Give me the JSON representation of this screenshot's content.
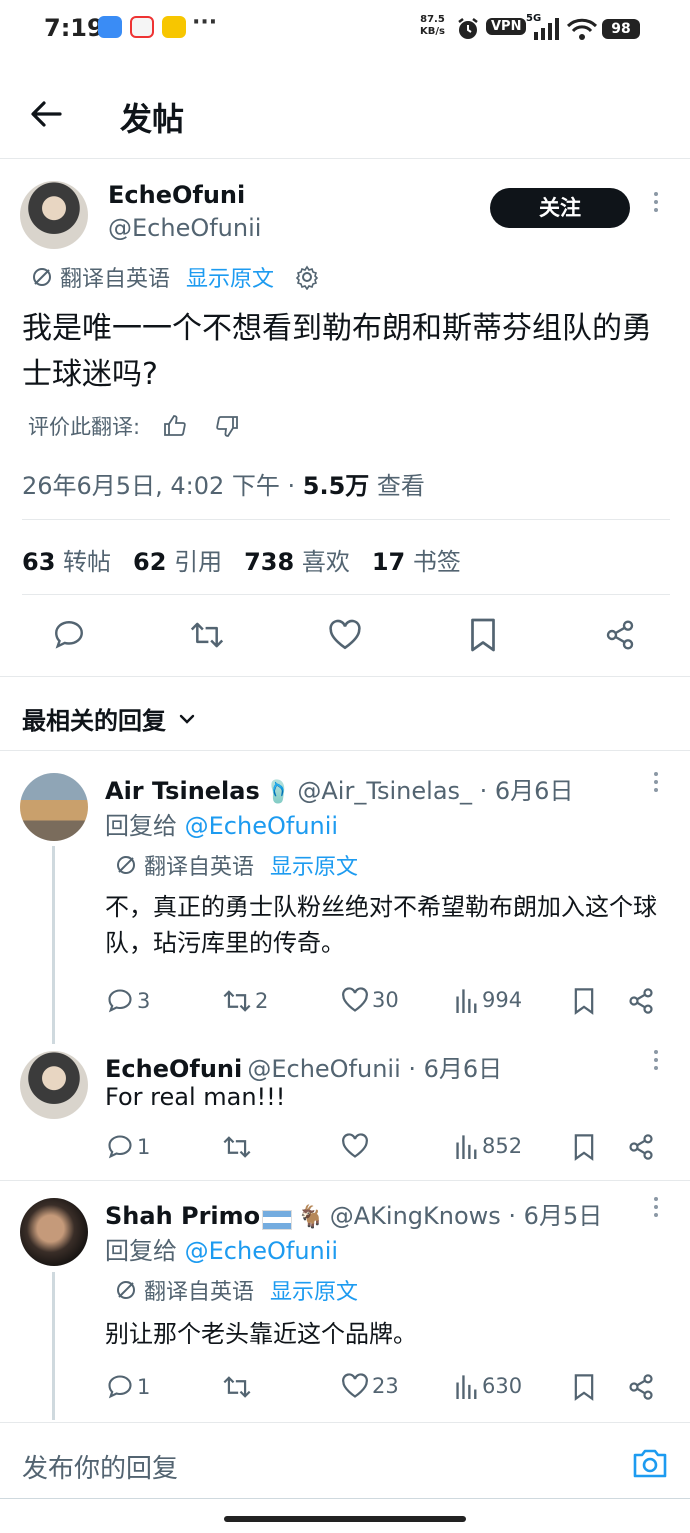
{
  "status_bar": {
    "time": "7:19",
    "net_speed": "87.5",
    "net_unit": "KB/s",
    "vpn": "VPN",
    "signal": "5G",
    "battery": "98"
  },
  "header": {
    "title": "发帖"
  },
  "post": {
    "author_name": "EcheOfuni",
    "author_handle": "@EcheOfunii",
    "follow_label": "关注",
    "translated_from": "翻译自英语",
    "show_original": "显示原文",
    "text": "我是唯一一个不想看到勒布朗和斯蒂芬组队的勇士球迷吗?",
    "rate_translation": "评价此翻译:",
    "timestamp": "26年6月5日, 4:02 下午 · ",
    "views_count": "5.5万",
    "views_label": " 查看",
    "stats": [
      {
        "num": "63",
        "label": "转帖"
      },
      {
        "num": "62",
        "label": "引用"
      },
      {
        "num": "738",
        "label": "喜欢"
      },
      {
        "num": "17",
        "label": "书签"
      }
    ]
  },
  "replies_sort": "最相关的回复",
  "replies": [
    {
      "name": "Air Tsinelas",
      "handle": "@Air_Tsinelas_ · 6月6日",
      "reply_to_prefix": "回复给 ",
      "reply_to": "@EcheOfunii",
      "translated_from": "翻译自英语",
      "show_original": "显示原文",
      "text": "不，真正的勇士队粉丝绝对不希望勒布朗加入这个球队，玷污库里的传奇。",
      "replies": "3",
      "reposts": "2",
      "likes": "30",
      "views": "994"
    },
    {
      "name": "EcheOfuni",
      "handle": "@EcheOfunii · 6月6日",
      "text": "For real man!!!",
      "replies": "1",
      "reposts": "",
      "likes": "",
      "views": "852"
    },
    {
      "name": "Shah Primo",
      "handle": "@AKingKnows · 6月5日",
      "reply_to_prefix": "回复给 ",
      "reply_to": "@EcheOfunii",
      "translated_from": "翻译自英语",
      "show_original": "显示原文",
      "text": "别让那个老头靠近这个品牌。",
      "replies": "1",
      "reposts": "",
      "likes": "23",
      "views": "630"
    }
  ],
  "composer": {
    "placeholder": "发布你的回复"
  },
  "colors": {
    "accent": "#1d9bf0",
    "text": "#0f1419",
    "muted": "#536471"
  }
}
